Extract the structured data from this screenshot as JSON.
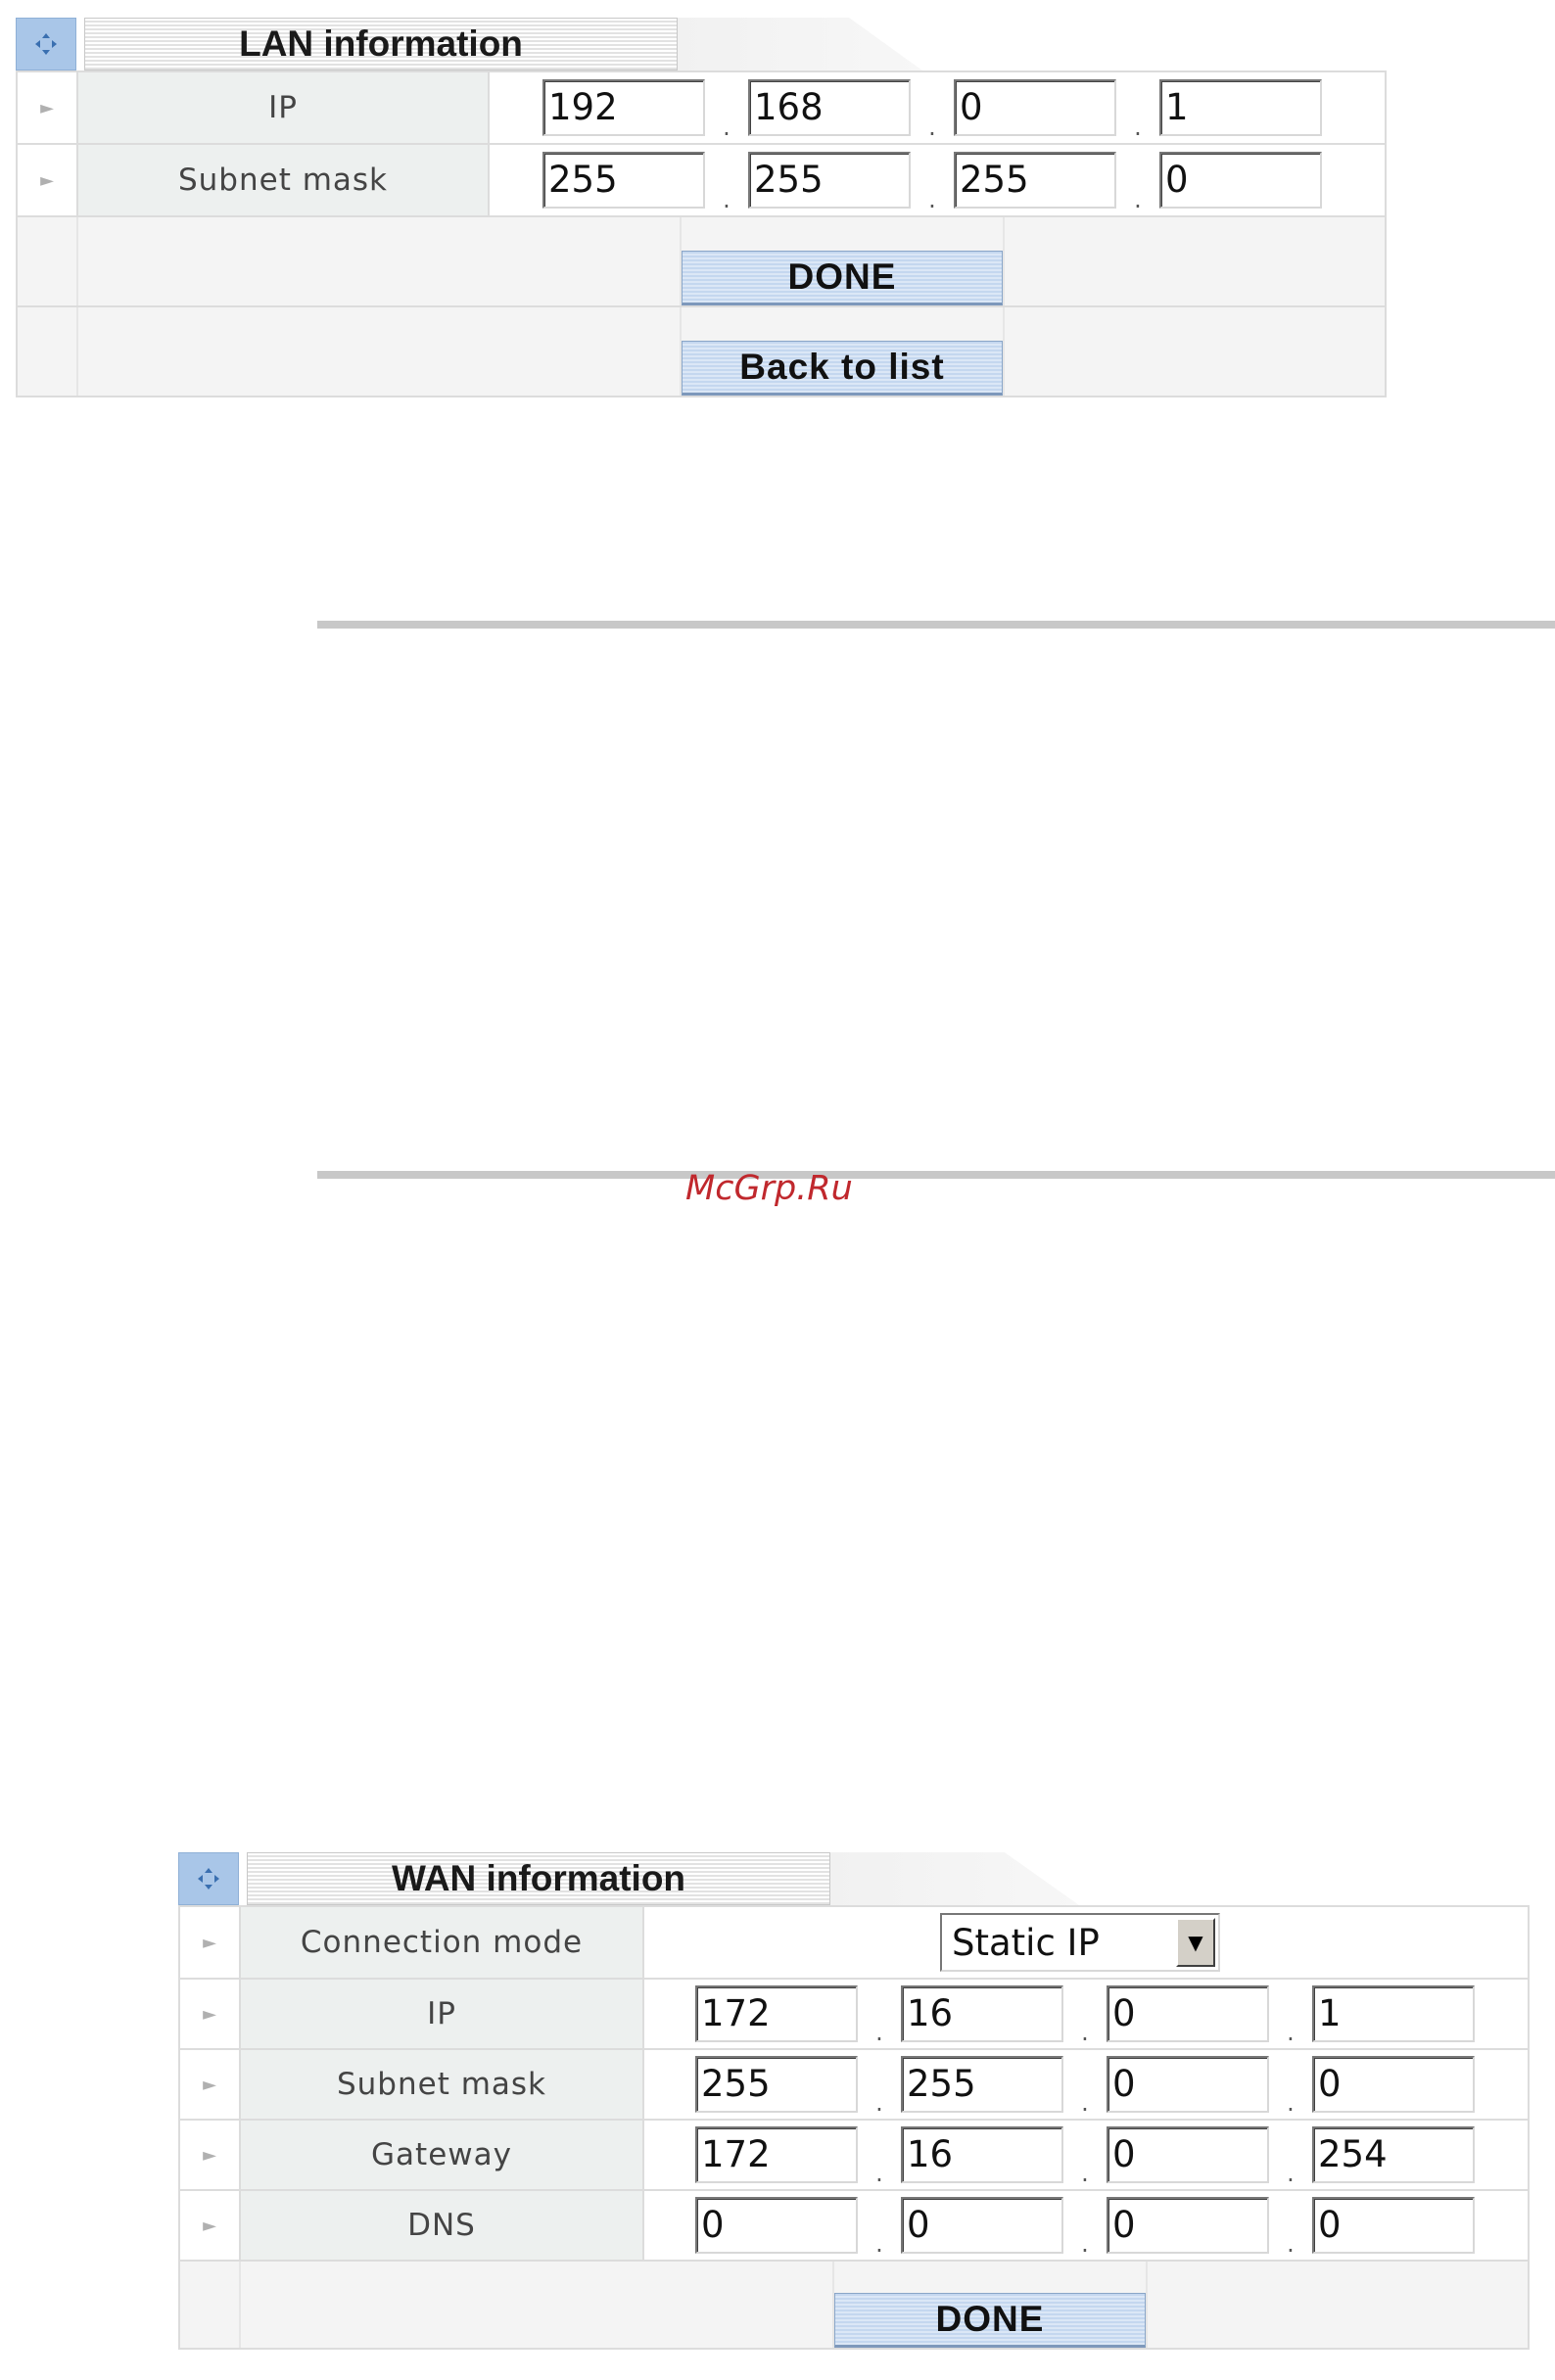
{
  "lan": {
    "title": "LAN information",
    "rows": [
      {
        "label": "IP",
        "octets": [
          "192",
          "168",
          "0",
          "1"
        ]
      },
      {
        "label": "Subnet mask",
        "octets": [
          "255",
          "255",
          "255",
          "0"
        ]
      }
    ],
    "buttons": {
      "done": "DONE",
      "back": "Back to list"
    }
  },
  "watermark": "McGrp.Ru",
  "wan": {
    "title": "WAN information",
    "connection_mode": {
      "label": "Connection mode",
      "value": "Static IP"
    },
    "rows": [
      {
        "label": "IP",
        "octets": [
          "172",
          "16",
          "0",
          "1"
        ]
      },
      {
        "label": "Subnet mask",
        "octets": [
          "255",
          "255",
          "0",
          "0"
        ]
      },
      {
        "label": "Gateway",
        "octets": [
          "172",
          "16",
          "0",
          "254"
        ]
      },
      {
        "label": "DNS",
        "octets": [
          "0",
          "0",
          "0",
          "0"
        ]
      }
    ],
    "buttons": {
      "done": "DONE"
    }
  },
  "icons": {
    "panel_icon": "collapse-icon",
    "row_icon": "arrow-right-icon",
    "select_icon": "dropdown-arrow-icon"
  },
  "colors": {
    "label_bg": "#edf0ef",
    "button_blue": "#c4d7ef",
    "watermark": "#c0282d"
  }
}
